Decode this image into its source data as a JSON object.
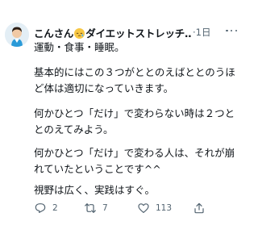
{
  "tweet": {
    "author_name": "こんさん",
    "author_name_suffix": "ダイエットストレッチ…",
    "time_ago": "·1日",
    "paragraphs": [
      "運動・食事・睡眠。",
      "基本的にはこの３つがととのえばととのうほど体は適切になっていきます。",
      "何かひとつ「だけ」で変わらない時は２つととのえてみよう。",
      "何かひとつ「だけ」で変わる人は、それが崩れていたということです^^",
      "視野は広く、実践はすぐ。"
    ]
  },
  "actions": {
    "reply_count": "2",
    "retweet_count": "7",
    "like_count": "113"
  },
  "icons": {
    "avatar": "avatar-photo",
    "emoji": "sleepy-face-emoji",
    "more": "more-horizontal-icon",
    "reply": "reply-icon",
    "retweet": "retweet-icon",
    "like": "heart-icon",
    "share": "share-icon"
  },
  "colors": {
    "text": "#0f1419",
    "muted": "#536471",
    "emoji": "#f7c744"
  }
}
